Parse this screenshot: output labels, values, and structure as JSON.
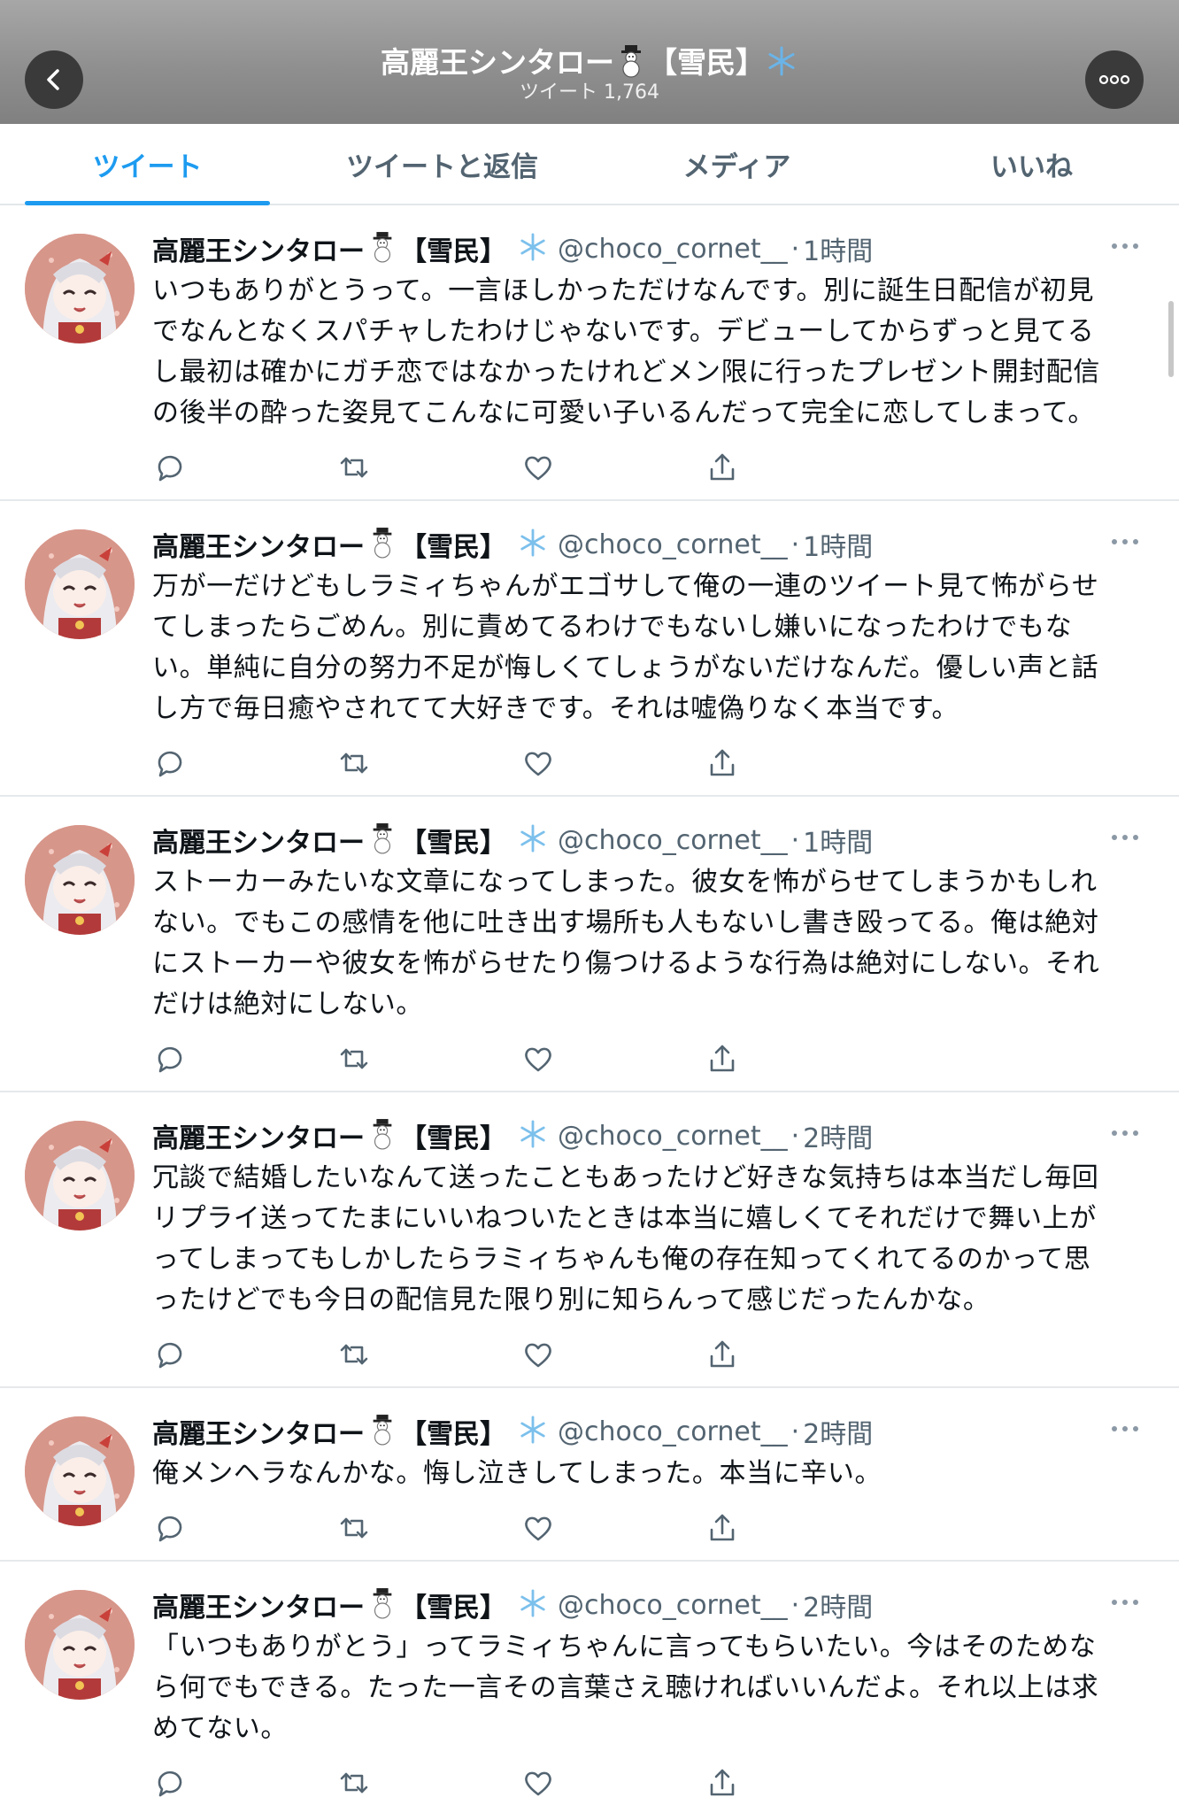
{
  "header": {
    "title_name": "高麗王シンタロー",
    "title_tag": "【雪民】",
    "subtitle": "ツイート 1,764",
    "icons": [
      "back-chevron-icon",
      "snowman-icon",
      "snowflake-icon",
      "more-dots-icon"
    ]
  },
  "tabs": [
    {
      "label": "ツイート",
      "active": true
    },
    {
      "label": "ツイートと返信",
      "active": false
    },
    {
      "label": "メディア",
      "active": false
    },
    {
      "label": "いいね",
      "active": false
    }
  ],
  "colors": {
    "accent": "#1d9bf0",
    "header_bg": "#8f8f8f",
    "muted": "#536471"
  },
  "tweets": [
    {
      "name": "高麗王シンタロー",
      "tag": "【雪民】",
      "handle": "@choco_cornet__",
      "dot": "·",
      "time": "1時間",
      "lines": [
        "いつもありがとうって。一言ほしかっただけなんです。別に誕生日配信が初見",
        "でなんとなくスパチャしたわけじゃないです。デビューしてからずっと見てる",
        "し最初は確かにガチ恋ではなかったけれどメン限に行ったプレゼント開封配信",
        "の後半の酔った姿見てこんなに可愛い子いるんだって完全に恋してしまって。"
      ]
    },
    {
      "name": "高麗王シンタロー",
      "tag": "【雪民】",
      "handle": "@choco_cornet__",
      "dot": "·",
      "time": "1時間",
      "lines": [
        "万が一だけどもしラミィちゃんがエゴサして俺の一連のツイート見て怖がらせ",
        "てしまったらごめん。別に責めてるわけでもないし嫌いになったわけでもな",
        "い。単純に自分の努力不足が悔しくてしょうがないだけなんだ。優しい声と話",
        "し方で毎日癒やされてて大好きです。それは嘘偽りなく本当です。"
      ]
    },
    {
      "name": "高麗王シンタロー",
      "tag": "【雪民】",
      "handle": "@choco_cornet__",
      "dot": "·",
      "time": "1時間",
      "lines": [
        "ストーカーみたいな文章になってしまった。彼女を怖がらせてしまうかもしれ",
        "ない。でもこの感情を他に吐き出す場所も人もないし書き殴ってる。俺は絶対",
        "にストーカーや彼女を怖がらせたり傷つけるような行為は絶対にしない。それ",
        "だけは絶対にしない。"
      ]
    },
    {
      "name": "高麗王シンタロー",
      "tag": "【雪民】",
      "handle": "@choco_cornet__",
      "dot": "·",
      "time": "2時間",
      "lines": [
        "冗談で結婚したいなんて送ったこともあったけど好きな気持ちは本当だし毎回",
        "リプライ送ってたまにいいねついたときは本当に嬉しくてそれだけで舞い上が",
        "ってしまってもしかしたらラミィちゃんも俺の存在知ってくれてるのかって思",
        "ったけどでも今日の配信見た限り別に知らんって感じだったんかな。"
      ]
    },
    {
      "name": "高麗王シンタロー",
      "tag": "【雪民】",
      "handle": "@choco_cornet__",
      "dot": "·",
      "time": "2時間",
      "lines": [
        "俺メンヘラなんかな。悔し泣きしてしまった。本当に辛い。"
      ]
    },
    {
      "name": "高麗王シンタロー",
      "tag": "【雪民】",
      "handle": "@choco_cornet__",
      "dot": "·",
      "time": "2時間",
      "lines": [
        "「いつもありがとう」ってラミィちゃんに言ってもらいたい。今はそのためな",
        "ら何でもできる。たった一言その言葉さえ聴ければいいんだよ。それ以上は求",
        "めてない。"
      ]
    }
  ]
}
